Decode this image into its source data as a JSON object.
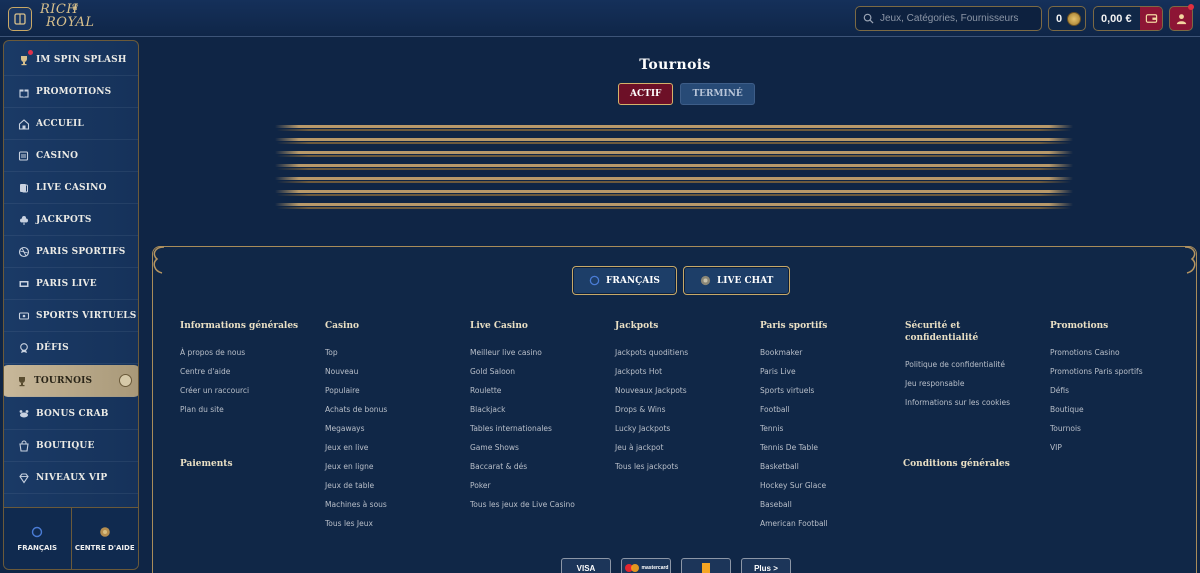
{
  "header": {
    "logo_line1": "RICH",
    "logo_line2": "ROYAL",
    "search_placeholder": "Jeux, Catégories, Fournisseurs",
    "coins": "0",
    "balance": "0,00 €"
  },
  "sidebar": {
    "items": [
      {
        "label": "IM SPIN SPLASH",
        "icon": "trophy-icon",
        "badge": true
      },
      {
        "label": "PROMOTIONS",
        "icon": "gift-icon"
      },
      {
        "label": "ACCUEIL",
        "icon": "home-icon"
      },
      {
        "label": "CASINO",
        "icon": "slot-icon"
      },
      {
        "label": "LIVE CASINO",
        "icon": "cards-icon"
      },
      {
        "label": "JACKPOTS",
        "icon": "clover-icon"
      },
      {
        "label": "PARIS SPORTIFS",
        "icon": "ball-icon"
      },
      {
        "label": "PARIS LIVE",
        "icon": "live-icon"
      },
      {
        "label": "SPORTS VIRTUELS",
        "icon": "virtual-icon"
      },
      {
        "label": "DÉFIS",
        "icon": "medal-icon"
      },
      {
        "label": "TOURNOIS",
        "icon": "cup-icon",
        "active": true
      },
      {
        "label": "BONUS CRAB",
        "icon": "crab-icon"
      },
      {
        "label": "BOUTIQUE",
        "icon": "shop-icon"
      },
      {
        "label": "NIVEAUX VIP",
        "icon": "diamond-icon"
      }
    ],
    "footer_lang": "FRANÇAIS",
    "footer_help": "CENTRE D'AIDE"
  },
  "main": {
    "title": "Tournois",
    "tab_active": "ACTIF",
    "tab_inactive": "TERMINÉ"
  },
  "footer": {
    "lang_button": "FRANÇAIS",
    "chat_button": "LIVE CHAT",
    "columns": [
      {
        "title": "Informations générales",
        "links": [
          "À propos de nous",
          "Centre d'aide",
          "Créer un raccourci",
          "Plan du site"
        ],
        "subtitle": "Paiements"
      },
      {
        "title": "Casino",
        "links": [
          "Top",
          "Nouveau",
          "Populaire",
          "Achats de bonus",
          "Megaways",
          "Jeux en live",
          "Jeux en ligne",
          "Jeux de table",
          "Machines à sous",
          "Tous les Jeux"
        ]
      },
      {
        "title": "Live Casino",
        "links": [
          "Meilleur live casino",
          "Gold Saloon",
          "Roulette",
          "Blackjack",
          "Tables internationales",
          "Game Shows",
          "Baccarat & dés",
          "Poker",
          "Tous les jeux de Live Casino"
        ]
      },
      {
        "title": "Jackpots",
        "links": [
          "Jackpots quoditiens",
          "Jackpots Hot",
          "Nouveaux Jackpots",
          "Drops & Wins",
          "Lucky Jackpots",
          "Jeu à jackpot",
          "Tous les jackpots"
        ]
      },
      {
        "title": "Paris sportifs",
        "links": [
          "Bookmaker",
          "Paris Live",
          "Sports virtuels",
          "Football",
          "Tennis",
          "Tennis De Table",
          "Basketball",
          "Hockey Sur Glace",
          "Baseball",
          "American Football"
        ]
      },
      {
        "title": "Sécurité et confidentialité",
        "links": [
          "Politique de confidentialité",
          "Jeu responsable",
          "Informations sur les cookies"
        ],
        "subtitle": "Conditions générales"
      },
      {
        "title": "Promotions",
        "links": [
          "Promotions Casino",
          "Promotions Paris sportifs",
          "Défis",
          "Boutique",
          "Tournois",
          "VIP"
        ]
      }
    ],
    "payments": [
      "VISA",
      "mastercard",
      "",
      "Plus  >"
    ]
  },
  "colors": {
    "background": "#0f2545",
    "gold": "#c9a865",
    "crimson": "#6d1027"
  }
}
